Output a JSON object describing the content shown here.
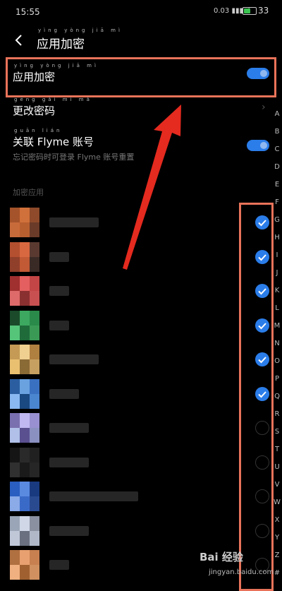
{
  "status": {
    "time": "15:55",
    "net": "0.03",
    "battery": "33"
  },
  "header": {
    "title": "应用加密",
    "pinyin": "yìng yòng jiā mì"
  },
  "settings": {
    "app_lock_label": "应用加密",
    "app_lock_pinyin": "yìng yòng jiā mì",
    "change_pwd_label": "更改密码",
    "change_pwd_pinyin": "gēng gǎi mì mǎ",
    "link_label": "关联 Flyme 账号",
    "link_pinyin": "guān lián",
    "link_sub": "忘记密码时可登录 Flyme 账号重置",
    "section_label": "加密应用"
  },
  "apps": [
    {
      "checked": true,
      "colors": [
        "#a5532a",
        "#d0703a",
        "#8e4a2a",
        "#c86b3b",
        "#b85f30",
        "#6a3b28"
      ]
    },
    {
      "checked": true,
      "colors": [
        "#b45030",
        "#d86840",
        "#5a3a30",
        "#903f2a",
        "#c25a35",
        "#3a2a26"
      ]
    },
    {
      "checked": true,
      "colors": [
        "#a02f2f",
        "#e45f5f",
        "#c34545",
        "#de6a6a",
        "#8a3030",
        "#c85050"
      ]
    },
    {
      "checked": true,
      "colors": [
        "#1a4a2a",
        "#3ca860",
        "#2a8a4a",
        "#55c57a",
        "#1f6b3a",
        "#3a9a55"
      ]
    },
    {
      "checked": true,
      "colors": [
        "#c49a55",
        "#f0d090",
        "#b08040",
        "#e8c070",
        "#8a6a35",
        "#c6a060"
      ]
    },
    {
      "checked": true,
      "colors": [
        "#2a5ea0",
        "#6aa2e0",
        "#3a70c0",
        "#8ab8f0",
        "#1a4880",
        "#4a85d0"
      ]
    },
    {
      "checked": false,
      "colors": [
        "#7a70b0",
        "#c0b8f0",
        "#9890d0",
        "#b0c0e8",
        "#5a5090",
        "#8a90c0"
      ]
    },
    {
      "checked": false,
      "colors": [
        "#151515",
        "#2a2a2a",
        "#202020",
        "#303030",
        "#1a1a1a",
        "#262626"
      ]
    },
    {
      "checked": false,
      "colors": [
        "#2a5ec0",
        "#5a8ae0",
        "#1a3a80",
        "#8aaae8",
        "#3a6ac8",
        "#2a4a90"
      ]
    },
    {
      "checked": false,
      "colors": [
        "#9aa6b8",
        "#d0d8e8",
        "#8a90a0",
        "#c0c8d8",
        "#6a7080",
        "#b0b8c8"
      ]
    },
    {
      "checked": false,
      "colors": [
        "#b07040",
        "#e8a070",
        "#c88050",
        "#f0b080",
        "#a06030",
        "#d09060"
      ]
    }
  ],
  "index_letters": [
    "A",
    "B",
    "C",
    "D",
    "E",
    "F",
    "G",
    "H",
    "I",
    "J",
    "K",
    "L",
    "M",
    "N",
    "O",
    "P",
    "Q",
    "R",
    "S",
    "T",
    "U",
    "V",
    "W",
    "X",
    "Y",
    "Z",
    "#"
  ],
  "watermark": {
    "brand": "Bai 经验",
    "url": "jingyan.baidu.com"
  }
}
